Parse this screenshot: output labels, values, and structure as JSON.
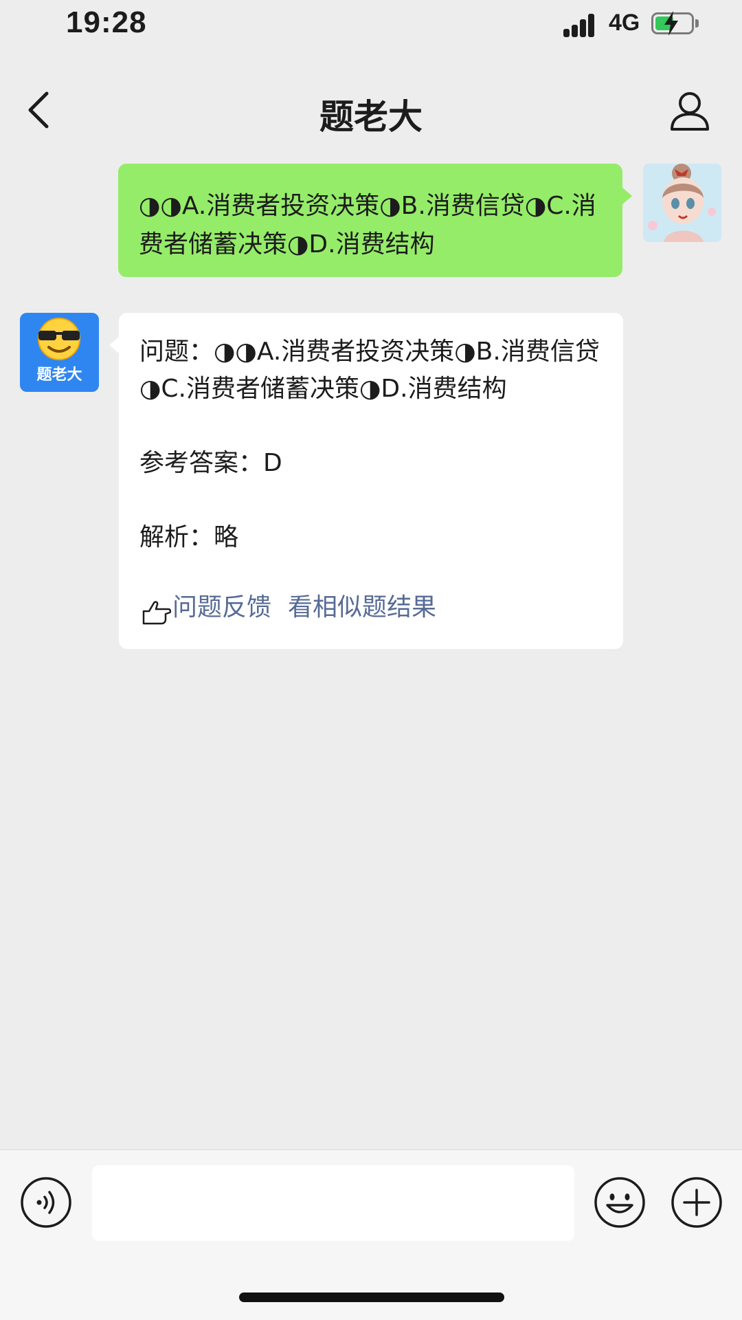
{
  "status_bar": {
    "time": "19:28",
    "network": "4G",
    "battery_charging": true
  },
  "nav": {
    "title": "题老大",
    "back_icon": "chevron-left-icon",
    "profile_icon": "person-icon"
  },
  "messages": {
    "sent": {
      "text": "◑◑A.消费者投资决策◑B.消费信贷◑C.消费者储蓄决策◑D.消费结构"
    },
    "received": {
      "sender_label": "题老大",
      "question": "问题：◑◑A.消费者投资决策◑B.消费信贷◑C.消费者储蓄决策◑D.消费结构",
      "answer": "参考答案：D",
      "analysis": "解析：略",
      "feedback_link": "问题反馈",
      "similar_link": "看相似题结果"
    }
  },
  "input_bar": {
    "voice_icon": "voice-icon",
    "emoji_icon": "emoji-icon",
    "plus_icon": "plus-icon",
    "input_value": ""
  },
  "colors": {
    "sent_bubble": "#95ec69",
    "link": "#576b95",
    "bot_avatar": "#2f86f0"
  }
}
